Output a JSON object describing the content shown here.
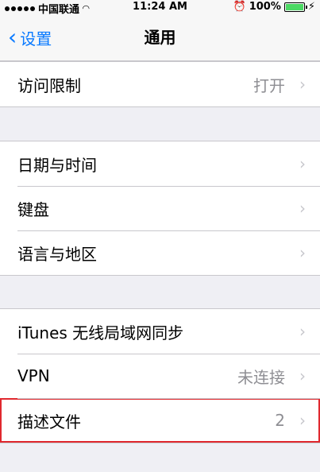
{
  "status": {
    "carrier": "中国联通",
    "time": "11:24 AM",
    "battery": "100%"
  },
  "nav": {
    "back_label": "设置",
    "title": "通用"
  },
  "groups": [
    {
      "rows": [
        {
          "label": "访问限制",
          "detail": "打开"
        }
      ]
    },
    {
      "rows": [
        {
          "label": "日期与时间",
          "detail": ""
        },
        {
          "label": "键盘",
          "detail": ""
        },
        {
          "label": "语言与地区",
          "detail": ""
        }
      ]
    },
    {
      "rows": [
        {
          "label": "iTunes 无线局域网同步",
          "detail": ""
        },
        {
          "label": "VPN",
          "detail": "未连接"
        },
        {
          "label": "描述文件",
          "detail": "2"
        }
      ]
    }
  ],
  "colors": {
    "accent": "#0a7aff",
    "highlight": "#e0282e"
  },
  "icons": {
    "back": "chevron-left-icon",
    "disclosure": "chevron-right-icon"
  }
}
